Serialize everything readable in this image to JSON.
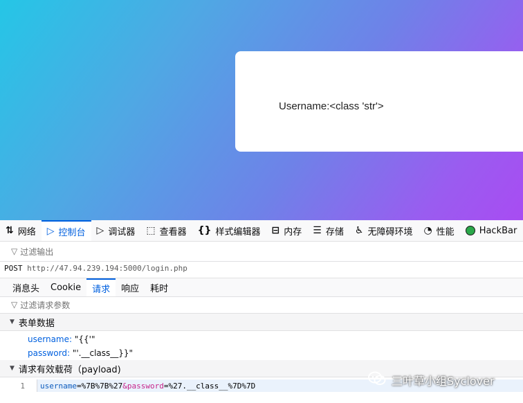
{
  "page": {
    "result_text": "Username:<class 'str'>"
  },
  "devtools": {
    "tools": [
      {
        "label": "网络",
        "icon": "⇅",
        "icon_name": "network-icon"
      },
      {
        "label": "控制台",
        "icon": "▷",
        "icon_name": "console-icon",
        "active": true
      },
      {
        "label": "调试器",
        "icon": "▷",
        "icon_name": "debugger-icon"
      },
      {
        "label": "查看器",
        "icon": "⬚",
        "icon_name": "inspector-icon"
      },
      {
        "label": "样式编辑器",
        "icon": "{}",
        "icon_name": "style-editor-icon"
      },
      {
        "label": "内存",
        "icon": "⊟",
        "icon_name": "memory-icon"
      },
      {
        "label": "存储",
        "icon": "☰",
        "icon_name": "storage-icon"
      },
      {
        "label": "无障碍环境",
        "icon": "♿",
        "icon_name": "accessibility-icon"
      },
      {
        "label": "性能",
        "icon": "◔",
        "icon_name": "performance-icon"
      },
      {
        "label": "HackBar",
        "icon_name": "hackbar-icon"
      }
    ],
    "filter_placeholder": "过滤输出",
    "request": {
      "method": "POST",
      "url": "http://47.94.239.194:5000/login.php"
    },
    "detail_tabs": [
      "消息头",
      "Cookie",
      "请求",
      "响应",
      "耗时"
    ],
    "active_detail_tab": "请求",
    "param_filter_placeholder": "过滤请求参数",
    "form_section_title": "表单数据",
    "form_fields": [
      {
        "key": "username:",
        "value": "\"{{'\""
      },
      {
        "key": "password:",
        "value": "\"'.__class__}}\""
      }
    ],
    "payload_section_title": "请求有效载荷（payload)",
    "payload": {
      "line_no": "1",
      "parts": [
        {
          "text": "username",
          "style": "k"
        },
        {
          "text": "=%7B%7B%27",
          "style": "v"
        },
        {
          "text": "&password",
          "style": "amp"
        },
        {
          "text": "=%27.__class__%7D%7D",
          "style": "v"
        }
      ]
    }
  },
  "watermark": {
    "text": "三叶草小组Syclover"
  },
  "colors": {
    "accent": "#0060df",
    "gradient_start": "#25c6e6",
    "gradient_end": "#a84cf2"
  }
}
